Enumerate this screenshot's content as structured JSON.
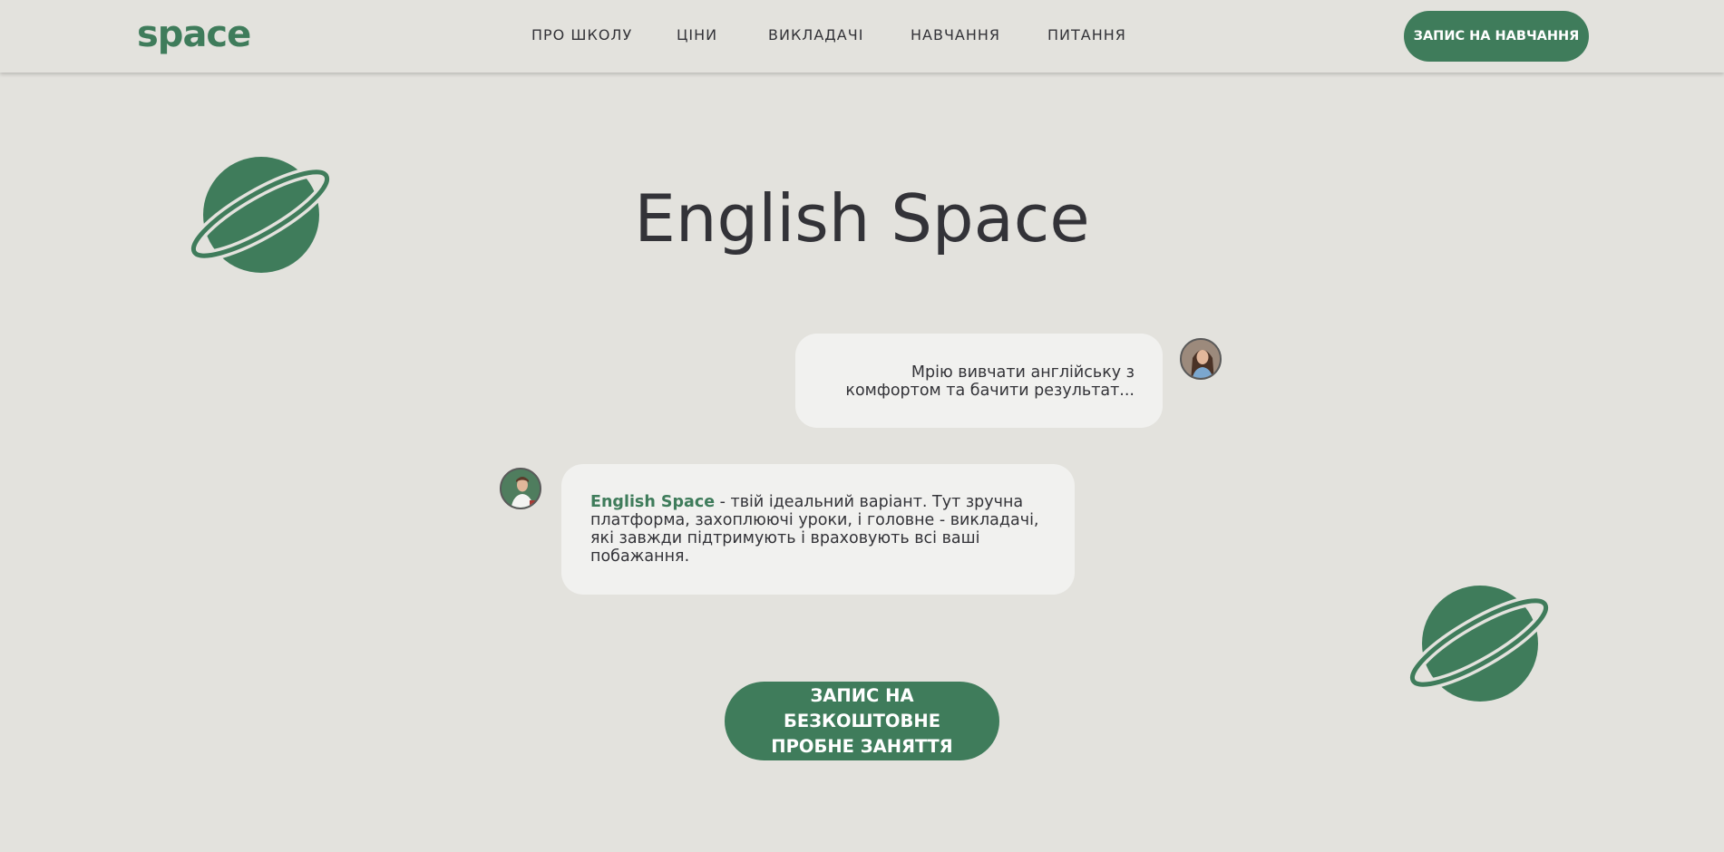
{
  "header": {
    "logo": "space",
    "nav": [
      {
        "label": "ПРО ШКОЛУ"
      },
      {
        "label": "ЦІНИ"
      },
      {
        "label": "ВИКЛАДАЧІ"
      },
      {
        "label": "НАВЧАННЯ"
      },
      {
        "label": "ПИТАННЯ"
      }
    ],
    "cta_label": "ЗАПИС НА НАВЧАННЯ"
  },
  "hero": {
    "title": "English Space"
  },
  "chat": {
    "student_message": "Мрію вивчати англійську з комфортом та бачити результат...",
    "teacher_message_brand": "English Space",
    "teacher_message_rest": " - твій ідеальний варіант. Тут зручна платформа, захоплюючі уроки, і головне - викладачі, які завжди підтримують і враховують всі ваші побажання."
  },
  "cta": {
    "label": "ЗАПИС НА БЕЗКОШТОВНЕ ПРОБНЕ ЗАНЯТТЯ"
  },
  "colors": {
    "accent": "#3f7c5b",
    "background": "#e3e2dd",
    "bubble": "#f1f1ef",
    "text": "#333338"
  }
}
